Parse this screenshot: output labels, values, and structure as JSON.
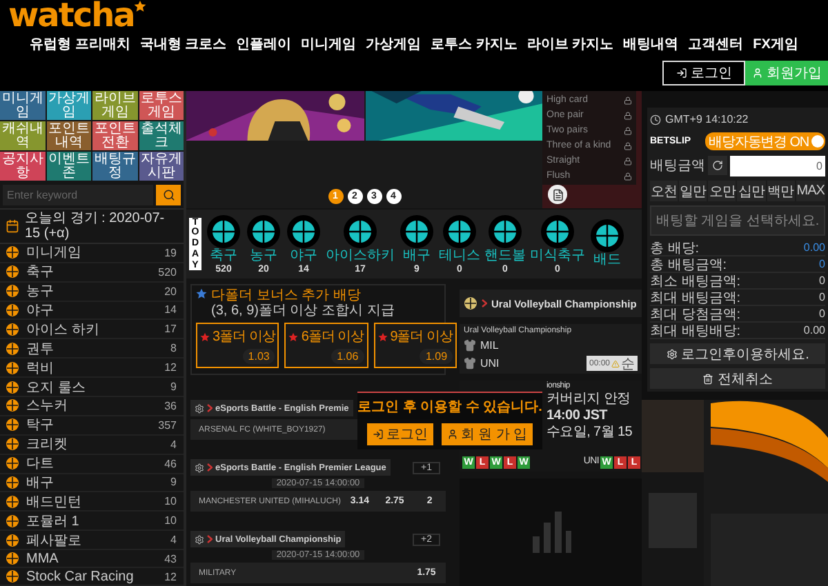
{
  "header": {
    "logo": "watcha",
    "nav": [
      "유럽형 프리매치",
      "국내형 크로스",
      "인플레이",
      "미니게임",
      "가상게임",
      "로투스 카지노",
      "라이브 카지노",
      "배팅내역",
      "고객센터",
      "FX게임"
    ],
    "auth_buttons": [
      {
        "label": "로그인",
        "kind": "login"
      },
      {
        "label": "회원가입",
        "kind": "register"
      }
    ]
  },
  "sidebar": {
    "tiles": [
      {
        "label": "미니게임",
        "color": "#33688f"
      },
      {
        "label": "가상게임",
        "color": "#2b9fb3"
      },
      {
        "label": "라이브게임",
        "color": "#86962e"
      },
      {
        "label": "로투스게임",
        "color": "#cf5656"
      },
      {
        "label": "캐쉬내역",
        "color": "#86962e"
      },
      {
        "label": "포인트내역",
        "color": "#8a5f2e"
      },
      {
        "label": "포인트전환",
        "color": "#cf5656"
      },
      {
        "label": "출석체크",
        "color": "#1f7a70"
      },
      {
        "label": "공지사항",
        "color": "#cf4458"
      },
      {
        "label": "이벤트존",
        "color": "#1f7a70"
      },
      {
        "label": "배팅규정",
        "color": "#33688f"
      },
      {
        "label": "자유게시판",
        "color": "#5a5a8e"
      }
    ],
    "search": {
      "placeholder": "Enter keyword"
    },
    "today": "오늘의 경기 : 2020-07-15 (+α)",
    "sports": [
      {
        "name": "미니게임",
        "count": "19"
      },
      {
        "name": "축구",
        "count": "520"
      },
      {
        "name": "농구",
        "count": "20"
      },
      {
        "name": "야구",
        "count": "14"
      },
      {
        "name": "아이스 하키",
        "count": "17"
      },
      {
        "name": "권투",
        "count": "8"
      },
      {
        "name": "럭비",
        "count": "12"
      },
      {
        "name": "오지 룰스",
        "count": "9"
      },
      {
        "name": "스누커",
        "count": "36"
      },
      {
        "name": "탁구",
        "count": "357"
      },
      {
        "name": "크리켓",
        "count": "4"
      },
      {
        "name": "다트",
        "count": "46"
      },
      {
        "name": "배구",
        "count": "9"
      },
      {
        "name": "배드민턴",
        "count": "10"
      },
      {
        "name": "포뮬러 1",
        "count": "10"
      },
      {
        "name": "페사팔로",
        "count": "4"
      },
      {
        "name": "MMA",
        "count": "43"
      },
      {
        "name": "Stock Car Racing",
        "count": "12"
      }
    ]
  },
  "banner": {
    "pages": [
      {
        "label": "1",
        "selected": true
      },
      {
        "label": "2",
        "selected": false
      },
      {
        "label": "3",
        "selected": false
      },
      {
        "label": "4",
        "selected": false
      }
    ],
    "poker_hands": [
      "High card",
      "One pair",
      "Two pairs",
      "Three of a kind",
      "Straight",
      "Flush"
    ]
  },
  "today_sports": {
    "label": "TODAY",
    "items": [
      {
        "name": "축구",
        "count": "520"
      },
      {
        "name": "농구",
        "count": "20"
      },
      {
        "name": "야구",
        "count": "14"
      },
      {
        "name": "아이스하키",
        "count": "17"
      },
      {
        "name": "배구",
        "count": "9"
      },
      {
        "name": "테니스",
        "count": "0"
      },
      {
        "name": "핸드볼",
        "count": "0"
      },
      {
        "name": "미식축구",
        "count": "0"
      },
      {
        "name": "배드"
      }
    ]
  },
  "bonus": {
    "title": "다폴더 보너스 추가 배당",
    "note": "(3, 6, 9)폴더 이상 조합시 지급",
    "options": [
      {
        "label": "3폴더 이상",
        "odds": "1.03"
      },
      {
        "label": "6폴더 이상",
        "odds": "1.06"
      },
      {
        "label": "9폴더 이상",
        "odds": "1.09"
      }
    ]
  },
  "match_list": [
    {
      "league": "eSports Battle - English Premie",
      "rows": [
        {
          "team": "ARSENAL FC (WHITE_BOY1927)"
        }
      ]
    },
    {
      "league": "eSports Battle - English Premier League",
      "extra": "+1",
      "time": "2020-07-15 14:00:00",
      "rows": [
        {
          "team": "MANCHESTER UNITED (MIHALUCH)",
          "odds": [
            "3.14",
            "2.75",
            "2"
          ]
        }
      ]
    },
    {
      "league": "Ural Volleyball Championship",
      "extra": "+2",
      "time": "2020-07-15 14:00:00",
      "rows": [
        {
          "team": "MILITARY",
          "odds": [
            "1.75"
          ]
        }
      ]
    }
  ],
  "login_prompt": {
    "message": "로그인 후 이용할 수 있습니다.",
    "buttons": [
      {
        "label": "로그인",
        "kind": "login"
      },
      {
        "label": "회 원 가 입",
        "kind": "register"
      }
    ]
  },
  "featured": {
    "league": "Ural Volleyball Championship",
    "card": {
      "league": "Ural Volleyball Championship",
      "teams": [
        "MIL",
        "UNI"
      ],
      "time_badge": "00:00",
      "status": "순"
    },
    "scoreboard": {
      "league": "ionship",
      "coverage": "커버리지 안정",
      "time": "14:00 JST",
      "date": "수요일, 7월 15",
      "away": "UNI",
      "home_form": [
        {
          "label": "W",
          "kind": "win"
        },
        {
          "label": "L",
          "kind": "loss"
        },
        {
          "label": "W",
          "kind": "win"
        },
        {
          "label": "L",
          "kind": "loss"
        },
        {
          "label": "W",
          "kind": "win"
        }
      ],
      "away_form": [
        {
          "label": "W",
          "kind": "win"
        },
        {
          "label": "L",
          "kind": "loss"
        },
        {
          "label": "L",
          "kind": "loss"
        }
      ]
    }
  },
  "betslip": {
    "clock": "GMT+9 14:10:22",
    "title": "BETSLIP",
    "auto_odds": {
      "label": "배당자동변경 ON",
      "on": true
    },
    "amount_label": "배팅금액",
    "amount": "0",
    "quick_amounts": [
      "오천",
      "일만",
      "오만",
      "십만",
      "백만",
      "MAX"
    ],
    "empty_message": "배팅할 게임을 선택하세요.",
    "totals": [
      {
        "label": "총 배당:",
        "value": "0.00",
        "highlight": true
      },
      {
        "label": "총 배팅금액:",
        "value": "0",
        "highlight": true
      },
      {
        "label": "최소 배팅금액:",
        "value": "0",
        "highlight": false
      },
      {
        "label": "최대 배팅금액:",
        "value": "0",
        "highlight": false
      },
      {
        "label": "최대 당첨금액:",
        "value": "0",
        "highlight": false
      },
      {
        "label": "최대 배팅배당:",
        "value": "0.00",
        "highlight": false
      }
    ],
    "actions": [
      {
        "label": "로그인후이용하세요.",
        "kind": "login"
      },
      {
        "label": "전체취소",
        "kind": "clear"
      }
    ]
  }
}
